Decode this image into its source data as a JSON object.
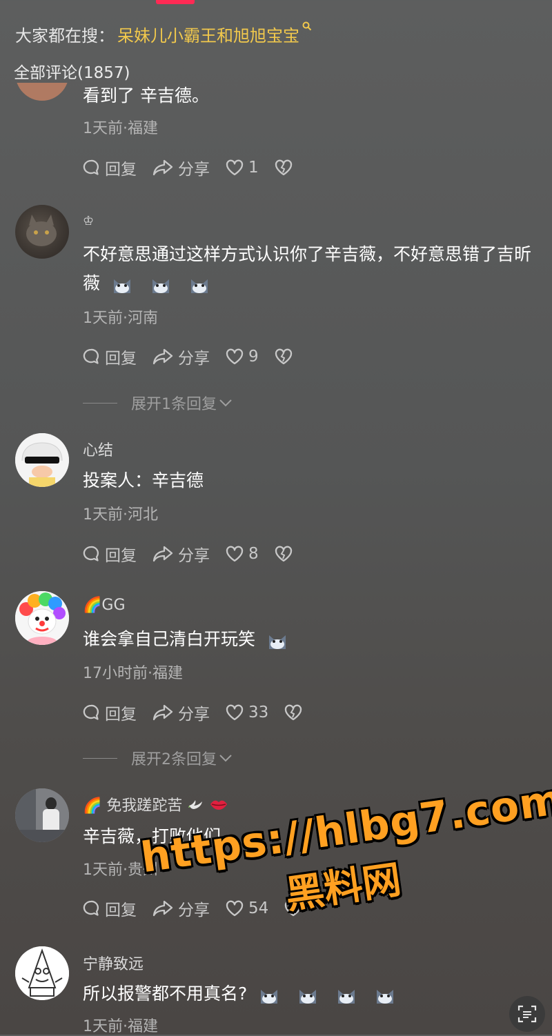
{
  "header": {
    "search_prefix": "大家都在搜：",
    "search_keyword": "呆妹儿小霸王和旭旭宝宝",
    "comment_count_label": "全部评论(1857)"
  },
  "actions": {
    "reply": "回复",
    "share": "分享"
  },
  "comments": [
    {
      "name": "",
      "text": "看到了 辛吉德。",
      "meta": "1天前·福建",
      "likes": "1"
    },
    {
      "name": "♔",
      "text": "不好意思通过这样方式认识你了辛吉薇，不好意思错了吉昕薇",
      "meta": "1天前·河南",
      "likes": "9",
      "expand": "展开1条回复"
    },
    {
      "name": "心结",
      "text": "投案人：辛吉德",
      "meta": "1天前·河北",
      "likes": "8"
    },
    {
      "name": "🌈GG",
      "text": "谁会拿自己清白开玩笑",
      "meta": "17小时前·福建",
      "likes": "33",
      "expand": "展开2条回复"
    },
    {
      "name": "🌈 免我蹉跎苦",
      "text": "辛吉薇，打败他们",
      "meta": "1天前·贵州",
      "likes": "54"
    },
    {
      "name": "宁静致远",
      "text": "所以报警都不用真名?",
      "meta": "1天前·福建",
      "likes": ""
    }
  ],
  "watermark": {
    "url": "https://hlbg7.com",
    "text": "黑料网"
  },
  "colors": {
    "accent": "#ff2a54",
    "keyword": "#f2c94c",
    "watermark": "#ffa021"
  }
}
